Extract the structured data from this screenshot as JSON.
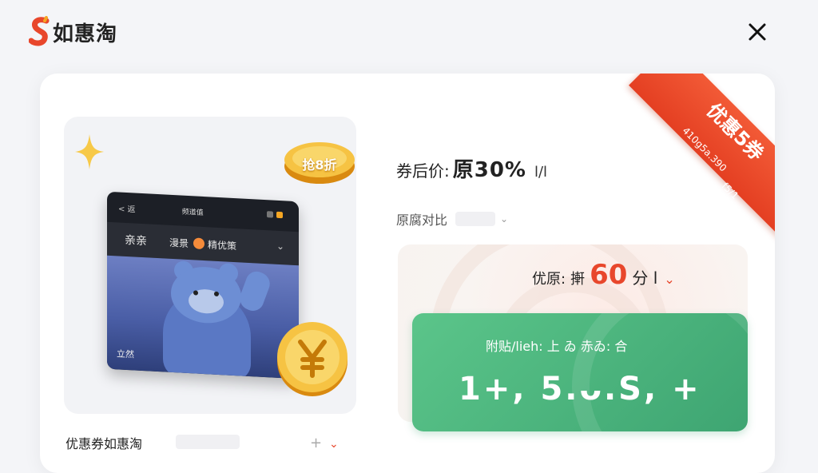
{
  "app": {
    "logo_text": "如惠淘"
  },
  "promo": {
    "coin_badge": "抢8折",
    "label": "优惠券如惠淘",
    "tablet": {
      "back": "< 返",
      "title": "频道值",
      "menu_item_1": "亲亲",
      "menu_item_2": "漫景",
      "menu_item_3": "精优策",
      "bottom_text": "立然"
    }
  },
  "price": {
    "label": "券后价:",
    "value": "原30%",
    "unit": "l/l"
  },
  "original": {
    "label": "原腐对比"
  },
  "coupon": {
    "label": "优原:",
    "prefix": "搟",
    "value": "60",
    "unit": "分 l"
  },
  "green_card": {
    "label": "附贴/lieh: 上 ゐ 赤ゐ: 合",
    "value": "1+, 5.ᴗ.S, +"
  },
  "ribbon": {
    "title": "优惠5券",
    "subtitle": "410g5a.390",
    "tail": "f5/1"
  },
  "colors": {
    "accent": "#e8472c",
    "green": "#4bb57e",
    "gold": "#f2b52c"
  }
}
